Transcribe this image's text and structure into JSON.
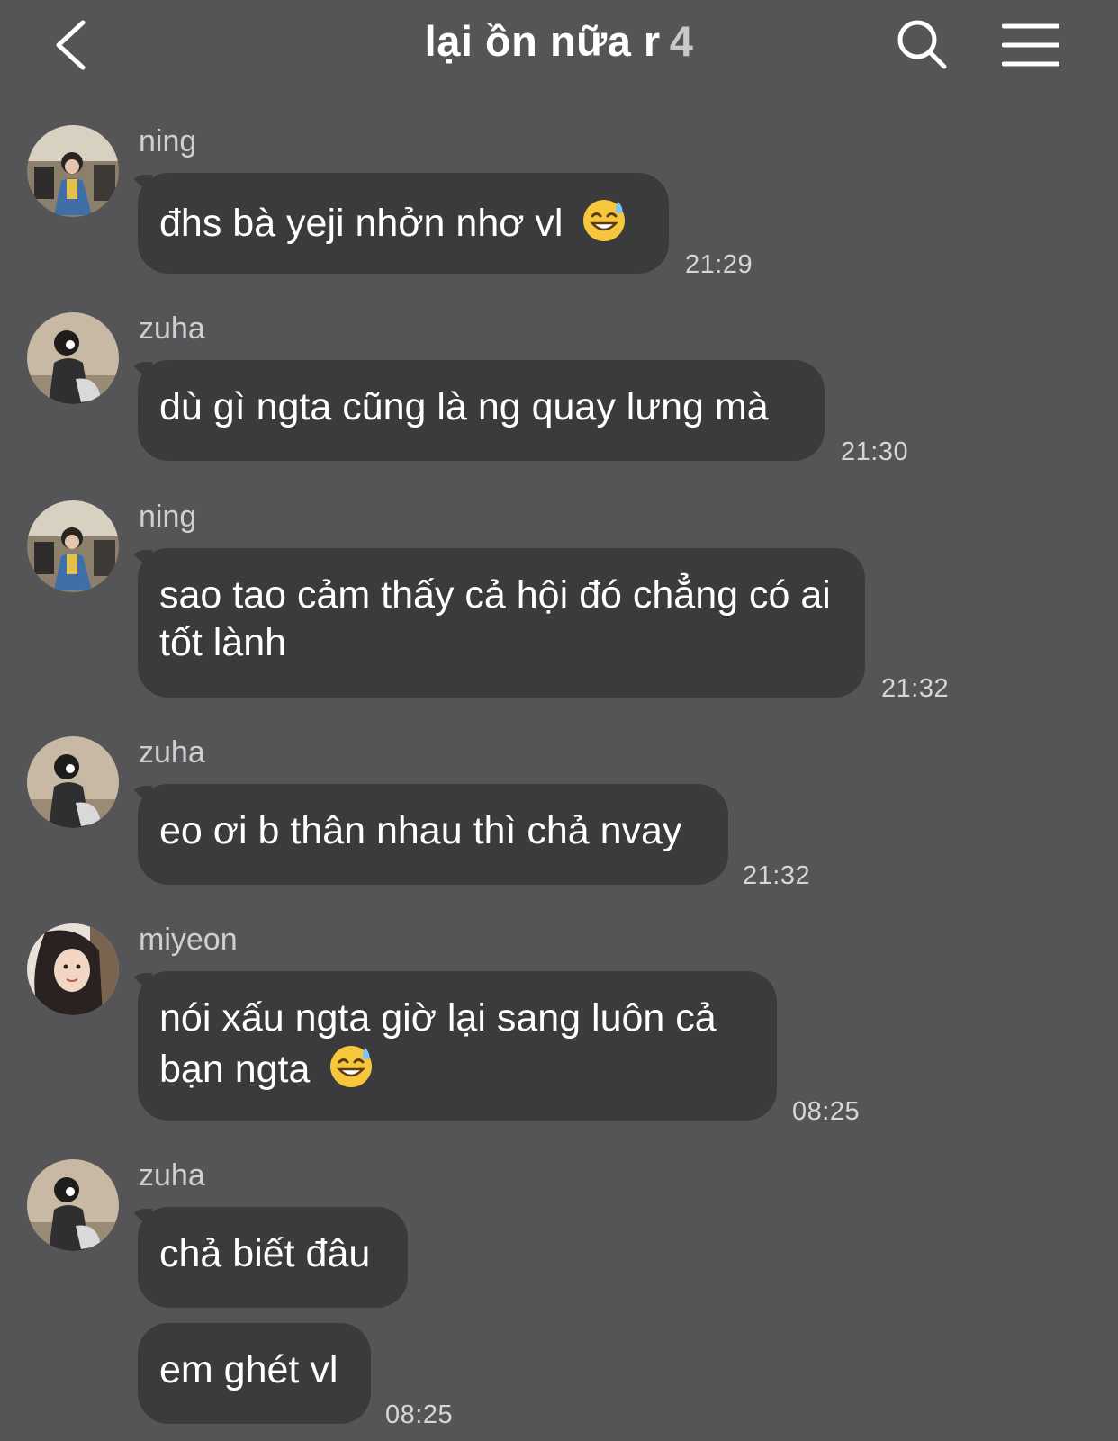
{
  "header": {
    "title": "lại ồn nữa r",
    "member_count": "4"
  },
  "messages": [
    {
      "sender": "ning",
      "text": "đhs bà yeji nhởn nhơ vl",
      "emoji": "sweat-smile-emoji",
      "time": "21:29"
    },
    {
      "sender": "zuha",
      "text": "dù gì ngta cũng là ng quay lưng mà",
      "time": "21:30"
    },
    {
      "sender": "ning",
      "text": "sao tao cảm thấy cả hội đó chẳng có ai tốt lành",
      "time": "21:32"
    },
    {
      "sender": "zuha",
      "text": "eo ơi b thân nhau thì chả nvay",
      "time": "21:32"
    },
    {
      "sender": "miyeon",
      "text": "nói xấu ngta giờ lại sang luôn cả bạn ngta",
      "emoji": "sweat-smile-emoji",
      "time": "08:25"
    },
    {
      "sender": "zuha",
      "text": "chả biết đâu"
    },
    {
      "text": "em ghét vl",
      "time": "08:25"
    }
  ],
  "colors": {
    "background": "#555457",
    "bubble": "#3b3b3e",
    "text": "#ffffff",
    "meta_text": "#cfcfd1"
  }
}
